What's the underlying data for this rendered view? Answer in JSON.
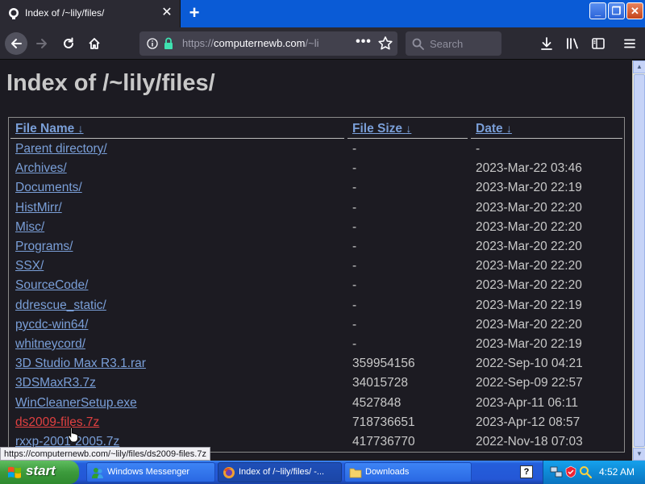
{
  "browser": {
    "tab_title": "Index of /~lily/files/",
    "url_prefix": "https://",
    "url_domain": "computernewb.com",
    "url_suffix": "/~li",
    "search_placeholder": "Search",
    "page_actions": "•••"
  },
  "page": {
    "title": "Index of /~lily/files/",
    "columns": {
      "name": "File Name",
      "size": "File Size",
      "date": "Date",
      "sort_arrow": "↓"
    },
    "rows": [
      {
        "name": "Parent directory/",
        "size": "-",
        "date": "-"
      },
      {
        "name": "Archives/",
        "size": "-",
        "date": "2023-Mar-22 03:46"
      },
      {
        "name": "Documents/",
        "size": "-",
        "date": "2023-Mar-20 22:19"
      },
      {
        "name": "HistMirr/",
        "size": "-",
        "date": "2023-Mar-20 22:20"
      },
      {
        "name": "Misc/",
        "size": "-",
        "date": "2023-Mar-20 22:20"
      },
      {
        "name": "Programs/",
        "size": "-",
        "date": "2023-Mar-20 22:20"
      },
      {
        "name": "SSX/",
        "size": "-",
        "date": "2023-Mar-20 22:20"
      },
      {
        "name": "SourceCode/",
        "size": "-",
        "date": "2023-Mar-20 22:20"
      },
      {
        "name": "ddrescue_static/",
        "size": "-",
        "date": "2023-Mar-20 22:19"
      },
      {
        "name": "pycdc-win64/",
        "size": "-",
        "date": "2023-Mar-20 22:20"
      },
      {
        "name": "whitneycord/",
        "size": "-",
        "date": "2023-Mar-20 22:19"
      },
      {
        "name": "3D Studio Max R3.1.rar",
        "size": "359954156",
        "date": "2022-Sep-10 04:21"
      },
      {
        "name": "3DSMaxR3.7z",
        "size": "34015728",
        "date": "2022-Sep-09 22:57"
      },
      {
        "name": "WinCleanerSetup.exe",
        "size": "4527848",
        "date": "2023-Apr-11 06:11"
      },
      {
        "name": "ds2009-files.7z",
        "size": "718736651",
        "date": "2023-Apr-12 08:57",
        "visited": true
      },
      {
        "name": "rxxp-2001-2005.7z",
        "size": "417736770",
        "date": "2022-Nov-18 07:03"
      }
    ]
  },
  "status_link": "https://computernewb.com/~lily/files/ds2009-files.7z",
  "taskbar": {
    "start_label": "start",
    "tasks": [
      {
        "label": "Windows Messenger",
        "icon": "messenger-icon"
      },
      {
        "label": "Index of /~lily/files/ -...",
        "icon": "firefox-icon"
      },
      {
        "label": "Downloads",
        "icon": "folder-icon"
      }
    ],
    "help_icon": "?",
    "clock": "4:52 AM"
  },
  "colors": {
    "accent_blue": "#0a5bd6",
    "link": "#7a9fd8",
    "visited_link": "#e04040",
    "page_bg": "#1c1b22"
  }
}
